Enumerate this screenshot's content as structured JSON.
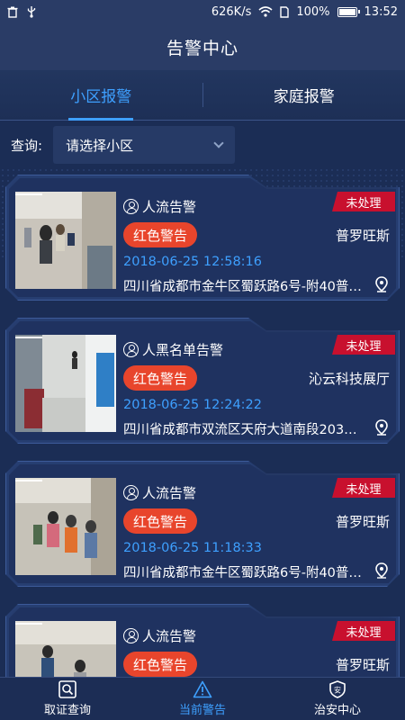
{
  "status_bar": {
    "speed": "626K/s",
    "battery": "100%",
    "time": "13:52"
  },
  "header": {
    "title": "告警中心"
  },
  "tabs": [
    {
      "label": "小区报警",
      "active": true
    },
    {
      "label": "家庭报警",
      "active": false
    }
  ],
  "query": {
    "label": "查询:",
    "select_value": "请选择小区"
  },
  "alerts": [
    {
      "type": "人流告警",
      "status": "未处理",
      "level": "红色警告",
      "place": "普罗旺斯",
      "time": "2018-06-25 12:58:16",
      "address": "四川省成都市金牛区蜀跃路6号-附40普…"
    },
    {
      "type": "人黑名单告警",
      "status": "未处理",
      "level": "红色警告",
      "place": "沁云科技展厅",
      "time": "2018-06-25 12:24:22",
      "address": "四川省成都市双流区天府大道南段203…"
    },
    {
      "type": "人流告警",
      "status": "未处理",
      "level": "红色警告",
      "place": "普罗旺斯",
      "time": "2018-06-25 11:18:33",
      "address": "四川省成都市金牛区蜀跃路6号-附40普…"
    },
    {
      "type": "人流告警",
      "status": "未处理",
      "level": "红色警告",
      "place": "普罗旺斯",
      "time": "",
      "address": ""
    }
  ],
  "bottom_nav": [
    {
      "label": "取证查询",
      "icon": "search-icon",
      "active": false
    },
    {
      "label": "当前警告",
      "icon": "warning-icon",
      "active": true
    },
    {
      "label": "治安中心",
      "icon": "shield-icon",
      "active": false
    }
  ],
  "colors": {
    "background": "#1b2d55",
    "accent": "#3ea0ff",
    "unhandled_badge": "#c8102e",
    "red_warning": "#e8452c"
  }
}
